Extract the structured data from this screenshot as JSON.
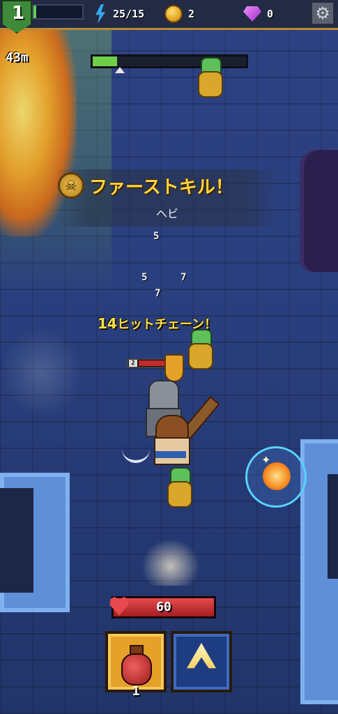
{
  "hud": {
    "level": "1",
    "xp_progress": 0.06,
    "energy": "25/15",
    "gold": "2",
    "gems": "0",
    "settings_icon": "gear-icon"
  },
  "run": {
    "distance": "43m",
    "stage_progress": 0.16
  },
  "combat": {
    "banner_title": "ファーストキル！",
    "banner_enemy": "ヘビ",
    "damage_numbers": [
      "5",
      "5",
      "7",
      "7"
    ],
    "chain_count": "14",
    "chain_label": "ヒットチェーン！",
    "enemy_tag_level": "2",
    "enemy_tag_hp": "13"
  },
  "player": {
    "hp": "60",
    "hp_fraction": 1.0
  },
  "skills": {
    "potion_count": "1",
    "potion_icon": "potion-icon",
    "skill_icon": "skill-arrow-icon"
  },
  "colors": {
    "accent_gold": "#e5a128",
    "hp_red": "#c42a2a",
    "xp_green": "#5ccf4e",
    "energy_blue": "#36a7f0"
  }
}
